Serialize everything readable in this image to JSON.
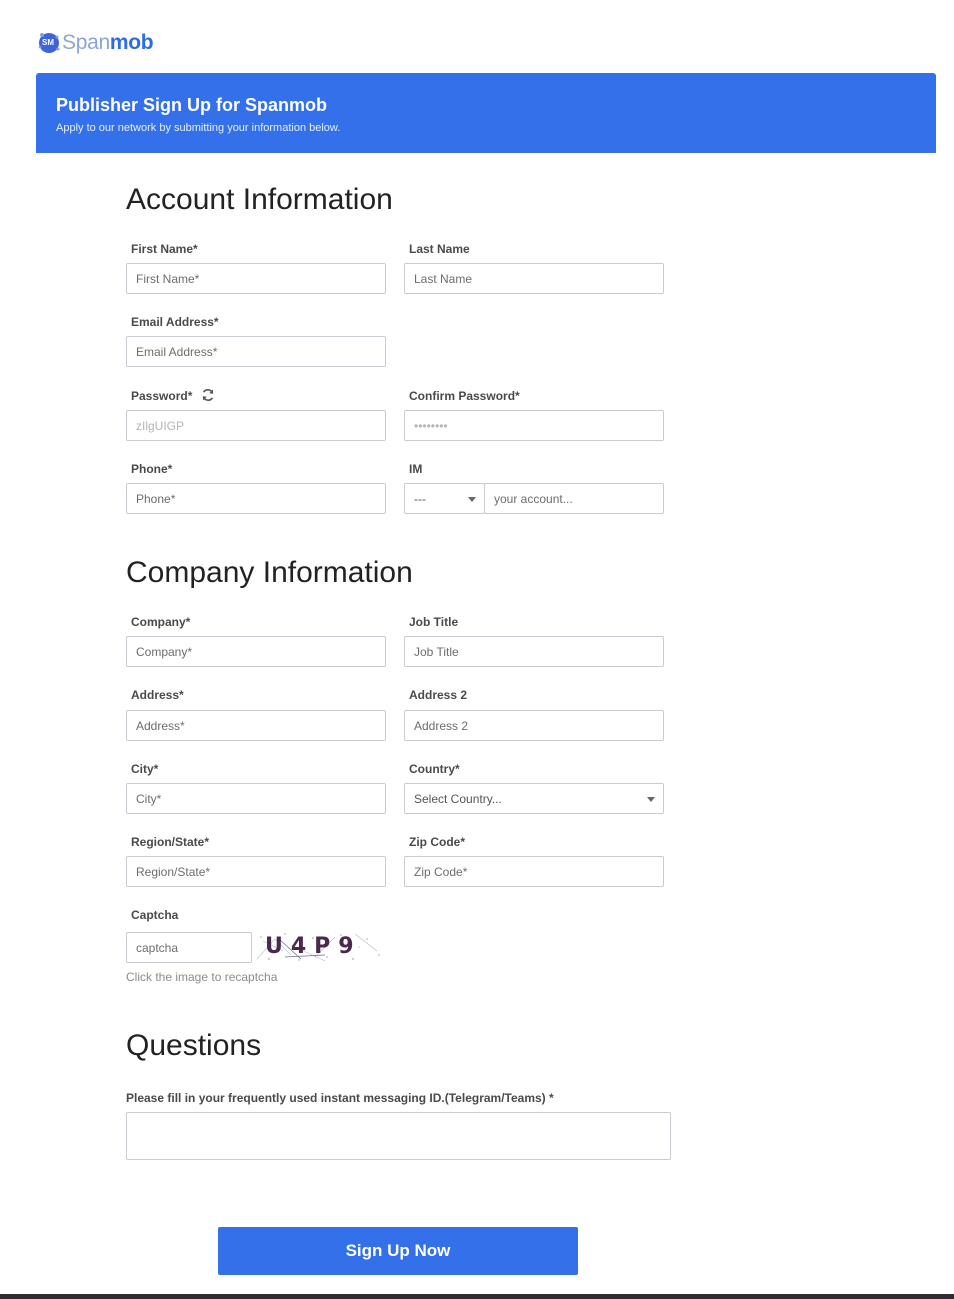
{
  "logo": {
    "text_a": "Span",
    "text_b": "mob",
    "mark_text": "SM"
  },
  "banner": {
    "title": "Publisher Sign Up for Spanmob",
    "subtitle": "Apply to our network by submitting your information below."
  },
  "account": {
    "title": "Account Information",
    "first_name": {
      "label": "First Name*",
      "placeholder": "First Name*"
    },
    "last_name": {
      "label": "Last Name",
      "placeholder": "Last Name"
    },
    "email": {
      "label": "Email Address*",
      "placeholder": "Email Address*"
    },
    "password": {
      "label": "Password*",
      "placeholder": "zIlgUIGP"
    },
    "confirm_password": {
      "label": "Confirm Password*",
      "placeholder": "••••••••"
    },
    "phone": {
      "label": "Phone*",
      "placeholder": "Phone*"
    },
    "im": {
      "label": "IM",
      "select_value": "---",
      "placeholder": "your account..."
    }
  },
  "company": {
    "title": "Company Information",
    "company": {
      "label": "Company*",
      "placeholder": "Company*"
    },
    "job_title": {
      "label": "Job Title",
      "placeholder": "Job Title"
    },
    "address": {
      "label": "Address*",
      "placeholder": "Address*"
    },
    "address2": {
      "label": "Address 2",
      "placeholder": "Address 2"
    },
    "city": {
      "label": "City*",
      "placeholder": "City*"
    },
    "country": {
      "label": "Country*",
      "select_value": "Select Country..."
    },
    "region": {
      "label": "Region/State*",
      "placeholder": "Region/State*"
    },
    "zip": {
      "label": "Zip Code*",
      "placeholder": "Zip Code*"
    },
    "captcha": {
      "label": "Captcha",
      "placeholder": "captcha",
      "image_text": "U4P9",
      "note": "Click the image to recaptcha"
    }
  },
  "questions": {
    "title": "Questions",
    "im_id_label": "Please fill in your frequently used instant messaging ID.(Telegram/Teams) *"
  },
  "submit_label": "Sign Up Now",
  "colors": {
    "primary": "#3370e9",
    "border": "#c8ccd2"
  }
}
